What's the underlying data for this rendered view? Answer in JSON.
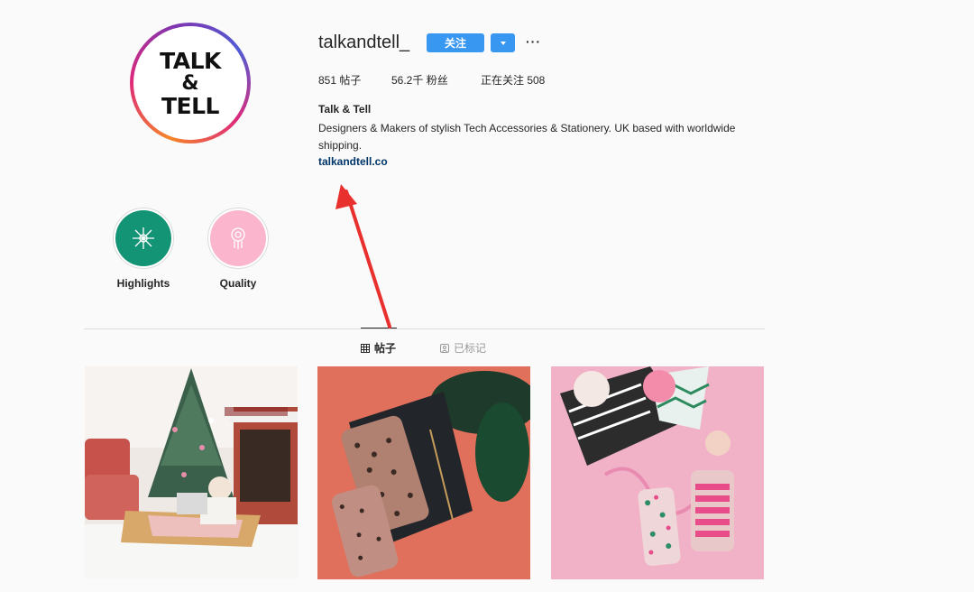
{
  "profile": {
    "avatar_lines": [
      "TALK",
      "&",
      "TELL"
    ],
    "username": "talkandtell_",
    "follow_label": "关注",
    "more_label": "···"
  },
  "stats": {
    "posts": "851 帖子",
    "followers": "56.2千 粉丝",
    "following": "正在关注 508"
  },
  "bio": {
    "name": "Talk & Tell",
    "text": "Designers & Makers of stylish Tech Accessories & Stationery. UK based with worldwide shipping.",
    "link": "talkandtell.co"
  },
  "highlights": [
    {
      "label": "Highlights",
      "color": "#139474",
      "icon": "sparkle-icon"
    },
    {
      "label": "Quality",
      "color": "#fbb6cd",
      "icon": "dreamcatcher-icon"
    }
  ],
  "tabs": [
    {
      "label": "帖子",
      "icon": "grid-icon",
      "active": true
    },
    {
      "label": "已标记",
      "icon": "tag-icon",
      "active": false
    }
  ],
  "posts": [
    {
      "icon": "christmas-tree-photo"
    },
    {
      "icon": "leopard-phone-cases-photo"
    },
    {
      "icon": "girls-phone-cases-photo"
    }
  ],
  "colors": {
    "accent": "#3897f0",
    "annotation_arrow": "#e8302f"
  }
}
